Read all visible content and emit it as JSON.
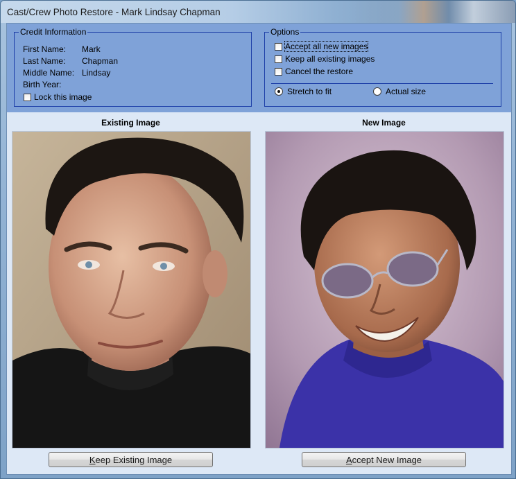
{
  "window": {
    "title": "Cast/Crew Photo Restore - Mark Lindsay Chapman"
  },
  "credit": {
    "legend": "Credit Information",
    "fields": [
      {
        "label": "First Name:",
        "value": "Mark"
      },
      {
        "label": "Last Name:",
        "value": "Chapman"
      },
      {
        "label": "Middle Name:",
        "value": "Lindsay"
      },
      {
        "label": "Birth Year:",
        "value": ""
      }
    ],
    "lock_label": "Lock this image",
    "lock_checked": false
  },
  "options": {
    "legend": "Options",
    "checkboxes": [
      {
        "label": "Accept all new images",
        "checked": false
      },
      {
        "label": "Keep all existing images",
        "checked": false
      },
      {
        "label": "Cancel the restore",
        "checked": false
      }
    ],
    "radios": [
      {
        "label": "Stretch to fit",
        "selected": true
      },
      {
        "label": "Actual size",
        "selected": false
      }
    ]
  },
  "existing": {
    "caption": "Existing Image",
    "button_mnemonic": "K",
    "button_rest": "eep Existing Image"
  },
  "new": {
    "caption": "New Image",
    "button_mnemonic": "A",
    "button_rest": "ccept New Image"
  },
  "colors": {
    "panel": "#7fa2d8",
    "groupbox_border": "#1d3fa8",
    "client_bg": "#dde8f6"
  }
}
